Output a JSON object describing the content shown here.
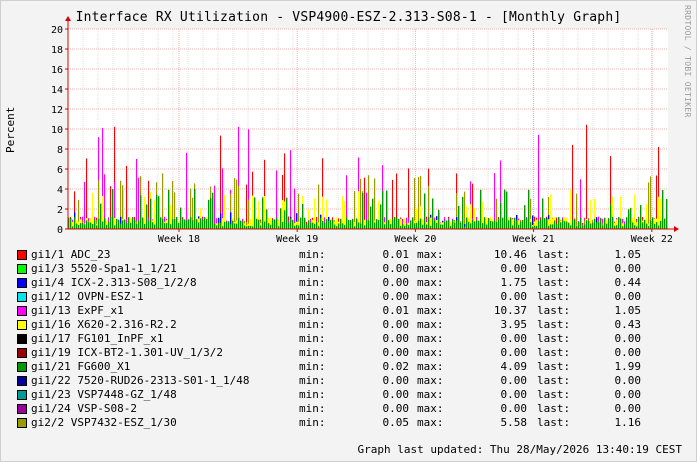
{
  "title": "Interface RX Utilization - VSP4900-ESZ-2.313-S08-1 - [Monthly Graph]",
  "watermark": "RRDTOOL / TOBI OETIKER",
  "legend_labels": {
    "min": "min:",
    "max": "max:",
    "last": "last:"
  },
  "footer": "Graph last updated: Thu 28/May/2026 13:40:19 CEST",
  "chart_data": {
    "type": "area",
    "title": "Interface RX Utilization - VSP4900-ESZ-2.313-S08-1 - [Monthly Graph]",
    "ylabel": "Percent",
    "xlabel": "",
    "ylim": [
      0,
      20
    ],
    "yticks": [
      0,
      2,
      4,
      6,
      8,
      10,
      12,
      14,
      16,
      18,
      20
    ],
    "xticks": [
      "Week 18",
      "Week 19",
      "Week 20",
      "Week 21",
      "Week 22"
    ],
    "grid": true,
    "legend_position": "bottom",
    "series": [
      {
        "name": "gi1/1 ADC_23",
        "color": "#ff0000",
        "min": "0.01",
        "max": "10.46",
        "last": "1.05"
      },
      {
        "name": "gi1/3 5520-Spa1-1_1/21",
        "color": "#00ff00",
        "min": "0.00",
        "max": "0.00",
        "last": "0.00"
      },
      {
        "name": "gi1/4 ICX-2.313-S08_1/2/8",
        "color": "#0000ff",
        "min": "0.00",
        "max": "1.75",
        "last": "0.44"
      },
      {
        "name": "gi1/12 OVPN-ESZ-1",
        "color": "#00e5ee",
        "min": "0.00",
        "max": "0.00",
        "last": "0.00"
      },
      {
        "name": "gi1/13 ExPF_x1",
        "color": "#ff00ff",
        "min": "0.01",
        "max": "10.37",
        "last": "1.05"
      },
      {
        "name": "gi1/16 X620-2.316-R2.2",
        "color": "#ffff00",
        "min": "0.00",
        "max": "3.95",
        "last": "0.43"
      },
      {
        "name": "gi1/17 FG101_InPF_x1",
        "color": "#000000",
        "min": "0.00",
        "max": "0.00",
        "last": "0.00"
      },
      {
        "name": "gi1/19 ICX-BT2-1.301-UV_1/3/2",
        "color": "#990000",
        "min": "0.00",
        "max": "0.00",
        "last": "0.00"
      },
      {
        "name": "gi1/21 FG600_X1",
        "color": "#009900",
        "min": "0.02",
        "max": "4.09",
        "last": "1.99"
      },
      {
        "name": "gi1/22 7520-RUD26-2313-S01-1_1/48",
        "color": "#000099",
        "min": "0.00",
        "max": "0.00",
        "last": "0.00"
      },
      {
        "name": "gi1/23 VSP7448-GZ_1/48",
        "color": "#009999",
        "min": "0.00",
        "max": "0.00",
        "last": "0.00"
      },
      {
        "name": "gi1/24 VSP-S08-2",
        "color": "#990099",
        "min": "0.00",
        "max": "0.00",
        "last": "0.00"
      },
      {
        "name": "gi2/2 VSP7432-ESZ_1/30",
        "color": "#999900",
        "min": "0.05",
        "max": "5.58",
        "last": "1.16"
      }
    ]
  }
}
